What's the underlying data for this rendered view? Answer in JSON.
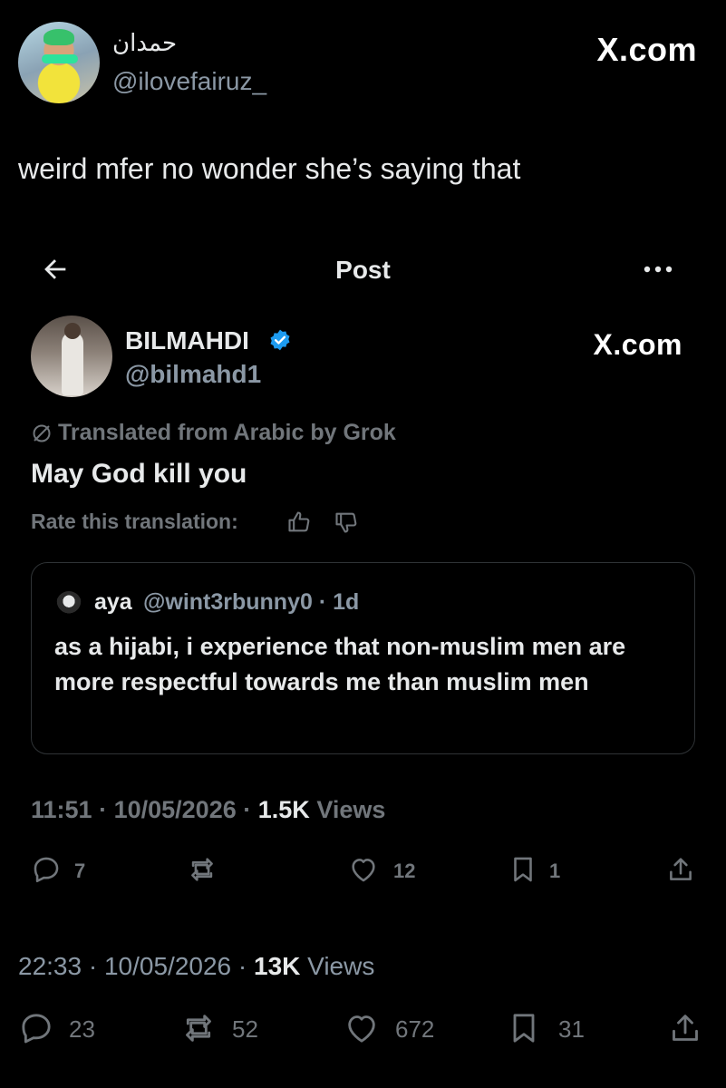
{
  "outer_tweet": {
    "author_name": "حمدان",
    "author_handle": "@ilovefairuz_",
    "watermark": "X.com",
    "text": "weird mfer no wonder she’s saying that",
    "time": "22:33",
    "date": "10/05/2026",
    "views_count": "13K",
    "views_label": "Views",
    "actions": {
      "replies": "23",
      "reposts": "52",
      "likes": "672",
      "bookmarks": "31"
    }
  },
  "embedded_post": {
    "nav_title": "Post",
    "author_name": "BILMAHDI",
    "author_handle": "@bilmahd1",
    "watermark": "X.com",
    "translated_note": "Translated from Arabic by Grok",
    "text": "May God kill you",
    "rate_label": "Rate this translation:",
    "quote": {
      "author_name": "aya",
      "author_handle": "@wint3rbunny0 · 1d",
      "text": "as a hijabi, i experience that non-muslim men are more respectful towards me than muslim men"
    },
    "time": "11:51",
    "date": "10/05/2026",
    "views_count": "1.5K",
    "views_label": "Views",
    "actions": {
      "replies": "7",
      "reposts": "",
      "likes": "12",
      "bookmarks": "1"
    }
  },
  "colors": {
    "background": "#000000",
    "text_primary": "#e7e9ea",
    "text_secondary": "#71767b",
    "verified": "#1d9bf0",
    "border": "#2f3336"
  }
}
